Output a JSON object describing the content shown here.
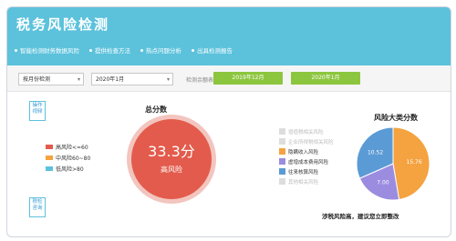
{
  "header": {
    "title": "税务风险检测",
    "nav": [
      "智能检测财务数据风险",
      "提供检查方法",
      "热点问题分析",
      "出具检测报告"
    ]
  },
  "toolbar": {
    "period_select": "按月份检测",
    "month_select": "2020年1月",
    "date_label": "检测余额表:",
    "btn_start": "2019年12月",
    "btn_end": "2020年1月"
  },
  "side": {
    "top_label": "操作 视频",
    "bottom_label": "税检 咨询"
  },
  "risk_legend": [
    {
      "label": "高风险<=60",
      "color": "#e35b4c"
    },
    {
      "label": "中风险60~80",
      "color": "#f4a340"
    },
    {
      "label": "低风险>80",
      "color": "#5cc2dc"
    }
  ],
  "total_score": {
    "title": "总分数",
    "score": "33.3分",
    "level": "高风险",
    "color": "#e35b4c"
  },
  "categories": {
    "title": "风险大类分数",
    "items": [
      {
        "label": "增值税相关风险",
        "color": "#dddddd",
        "faded": true
      },
      {
        "label": "企业所得税相关风险",
        "color": "#dddddd",
        "faded": true
      },
      {
        "label": "隐瞒收入风险",
        "color": "#f4a340",
        "faded": false
      },
      {
        "label": "虚增成本费用风险",
        "color": "#9b8ce0",
        "faded": false
      },
      {
        "label": "往来核算风险",
        "color": "#5b9bd5",
        "faded": false
      },
      {
        "label": "其他相关风险",
        "color": "#dddddd",
        "faded": true
      }
    ]
  },
  "chart_data": {
    "type": "pie",
    "slices": [
      {
        "name": "隐瞒收入风险",
        "value": 15.76,
        "color": "#f4a340"
      },
      {
        "name": "虚增成本费用风险",
        "value": 7.0,
        "color": "#9b8ce0"
      },
      {
        "name": "往来核算风险",
        "value": 10.52,
        "color": "#5b9bd5"
      }
    ]
  },
  "advice": "涉税风险高，建议您立即整改"
}
